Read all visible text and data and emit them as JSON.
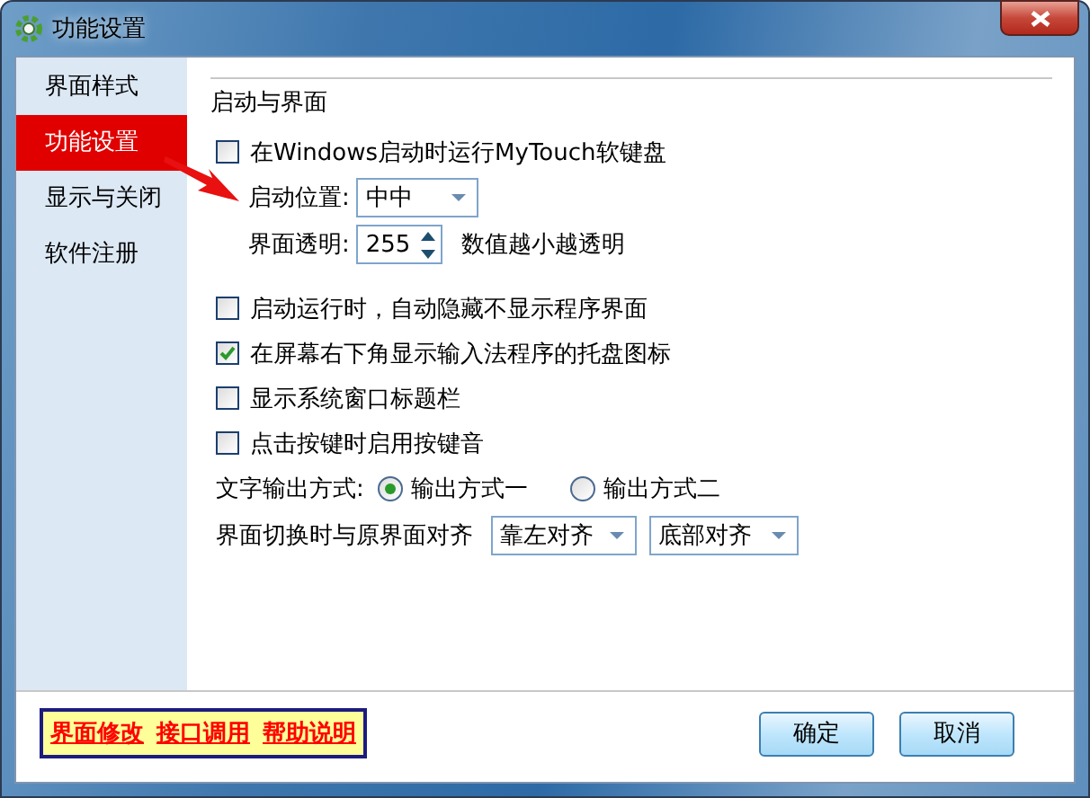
{
  "window": {
    "title": "功能设置"
  },
  "sidebar": {
    "items": [
      {
        "label": "界面样式",
        "selected": false
      },
      {
        "label": "功能设置",
        "selected": true
      },
      {
        "label": "显示与关闭",
        "selected": false
      },
      {
        "label": "软件注册",
        "selected": false
      }
    ]
  },
  "section": {
    "title": "启动与界面"
  },
  "options": [
    {
      "kind": "checkbox",
      "label": "在Windows启动时运行MyTouch软键盘",
      "checked": false
    },
    {
      "kind": "dropdown",
      "label": "启动位置:",
      "value": "中中"
    },
    {
      "kind": "spinner",
      "label": "界面透明:",
      "value": "255",
      "hint": "数值越小越透明"
    },
    {
      "kind": "checkbox",
      "label": "启动运行时，自动隐藏不显示程序界面",
      "checked": false
    },
    {
      "kind": "checkbox",
      "label": "在屏幕右下角显示输入法程序的托盘图标",
      "checked": true
    },
    {
      "kind": "checkbox",
      "label": "显示系统窗口标题栏",
      "checked": false
    },
    {
      "kind": "checkbox",
      "label": "点击按键时启用按键音",
      "checked": false
    },
    {
      "kind": "radio",
      "label": "文字输出方式:",
      "choices": [
        {
          "label": "输出方式一",
          "selected": true
        },
        {
          "label": "输出方式二",
          "selected": false
        }
      ]
    },
    {
      "kind": "align",
      "label": "界面切换时与原界面对齐",
      "values": [
        "靠左对齐",
        "底部对齐"
      ]
    }
  ],
  "footer": {
    "links": [
      "界面修改",
      "接口调用",
      "帮助说明"
    ],
    "buttons": [
      "确定",
      "取消"
    ]
  }
}
